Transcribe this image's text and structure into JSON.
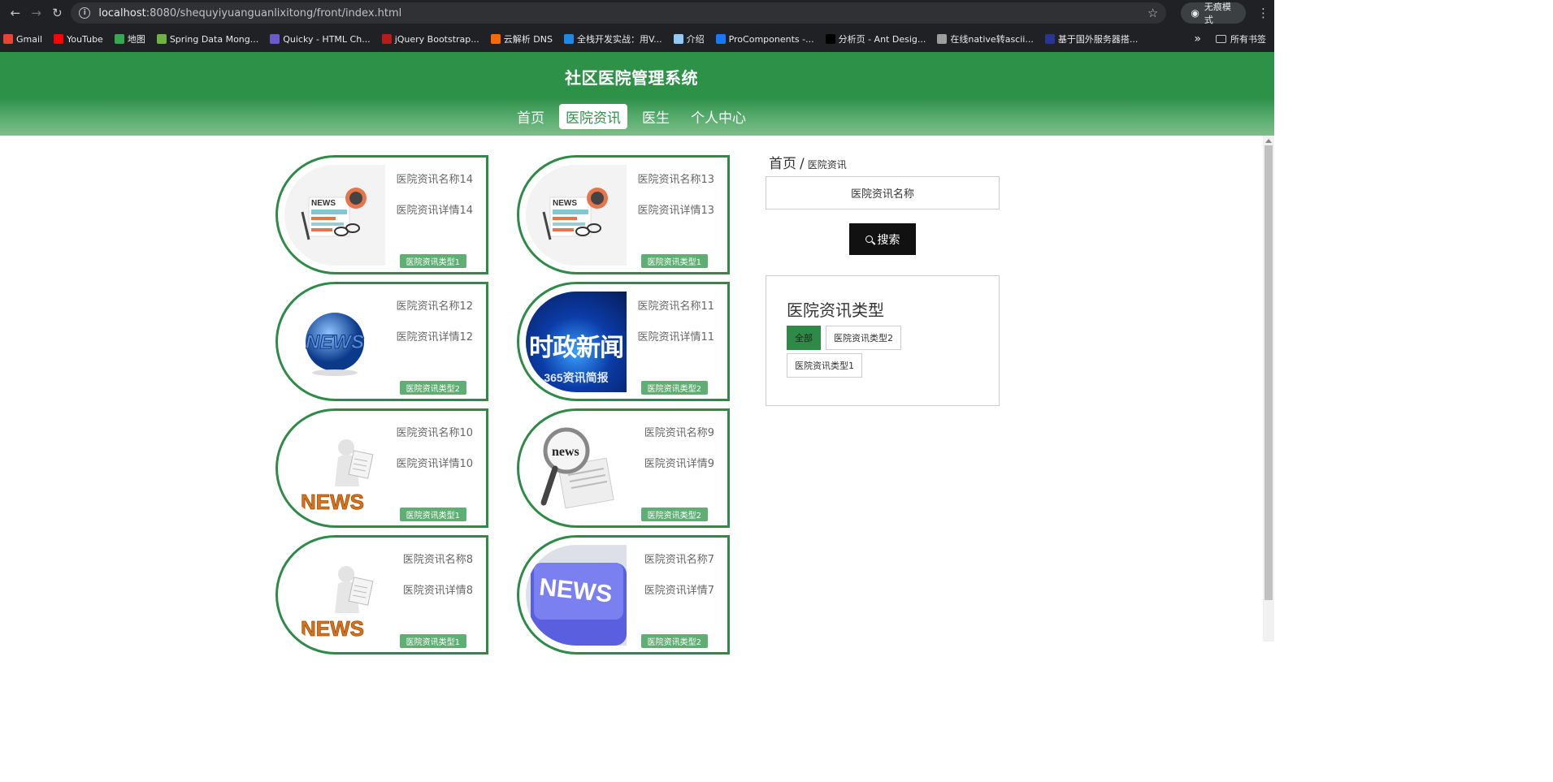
{
  "browser": {
    "url_host": "localhost",
    "url_rest": ":8080/shequyiyuanguanlixitong/front/index.html",
    "incognito_label": "无痕模式",
    "bookmarks": [
      {
        "label": "Gmail",
        "color": "#ea4335"
      },
      {
        "label": "YouTube",
        "color": "#ff0000"
      },
      {
        "label": "地图",
        "color": "#34a853"
      },
      {
        "label": "Spring Data Mong...",
        "color": "#6db33f"
      },
      {
        "label": "Quicky - HTML Ch...",
        "color": "#6a5acd"
      },
      {
        "label": "jQuery Bootstrap...",
        "color": "#b71c1c"
      },
      {
        "label": "云解析 DNS",
        "color": "#ff6a00"
      },
      {
        "label": "全栈开发实战：用V...",
        "color": "#1e88e5"
      },
      {
        "label": "介绍",
        "color": "#90caf9"
      },
      {
        "label": "ProComponents -...",
        "color": "#1677ff"
      },
      {
        "label": "分析页 - Ant Desig...",
        "color": "#000000"
      },
      {
        "label": "在线native转ascii...",
        "color": "#9e9e9e"
      },
      {
        "label": "基于国外服务器搭...",
        "color": "#283593"
      }
    ],
    "all_bookmarks_label": "所有书签",
    "more_label": "»"
  },
  "header": {
    "title": "社区医院管理系统",
    "nav": [
      {
        "label": "首页",
        "active": false
      },
      {
        "label": "医院资讯",
        "active": true
      },
      {
        "label": "医生",
        "active": false
      },
      {
        "label": "个人中心",
        "active": false
      }
    ]
  },
  "cards": [
    {
      "name": "医院资讯名称14",
      "detail": "医院资讯详情14",
      "type": "医院资讯类型1",
      "image": "news-paper-icon"
    },
    {
      "name": "医院资讯名称13",
      "detail": "医院资讯详情13",
      "type": "医院资讯类型1",
      "image": "news-paper-icon"
    },
    {
      "name": "医院资讯名称12",
      "detail": "医院资讯详情12",
      "type": "医院资讯类型2",
      "image": "news-globe-icon"
    },
    {
      "name": "医院资讯名称11",
      "detail": "医院资讯详情11",
      "type": "医院资讯类型2",
      "image": "political-news-banner",
      "image_text": "时政新闻",
      "image_subtext": "365资讯简报"
    },
    {
      "name": "医院资讯名称10",
      "detail": "医院资讯详情10",
      "type": "医院资讯类型1",
      "image": "news-reader-icon",
      "image_text": "NEWS"
    },
    {
      "name": "医院资讯名称9",
      "detail": "医院资讯详情9",
      "type": "医院资讯类型2",
      "image": "magnifier-newspaper-icon",
      "image_text": "news"
    },
    {
      "name": "医院资讯名称8",
      "detail": "医院资讯详情8",
      "type": "医院资讯类型1",
      "image": "news-reader-icon",
      "image_text": "NEWS"
    },
    {
      "name": "医院资讯名称7",
      "detail": "医院资讯详情7",
      "type": "医院资讯类型2",
      "image": "news-key-icon",
      "image_text": "NEWS"
    }
  ],
  "sidebar": {
    "breadcrumb_home": "首页",
    "breadcrumb_sep": "/",
    "breadcrumb_current": "医院资讯",
    "search_placeholder": "医院资讯名称",
    "search_button": "搜索",
    "type_title": "医院资讯类型",
    "types": [
      {
        "label": "全部",
        "active": true
      },
      {
        "label": "医院资讯类型2",
        "active": false
      },
      {
        "label": "医院资讯类型1",
        "active": false
      }
    ]
  },
  "colors": {
    "brand_green": "#2e9148",
    "card_border": "#2e8b47",
    "tag_green": "#5fae74"
  }
}
